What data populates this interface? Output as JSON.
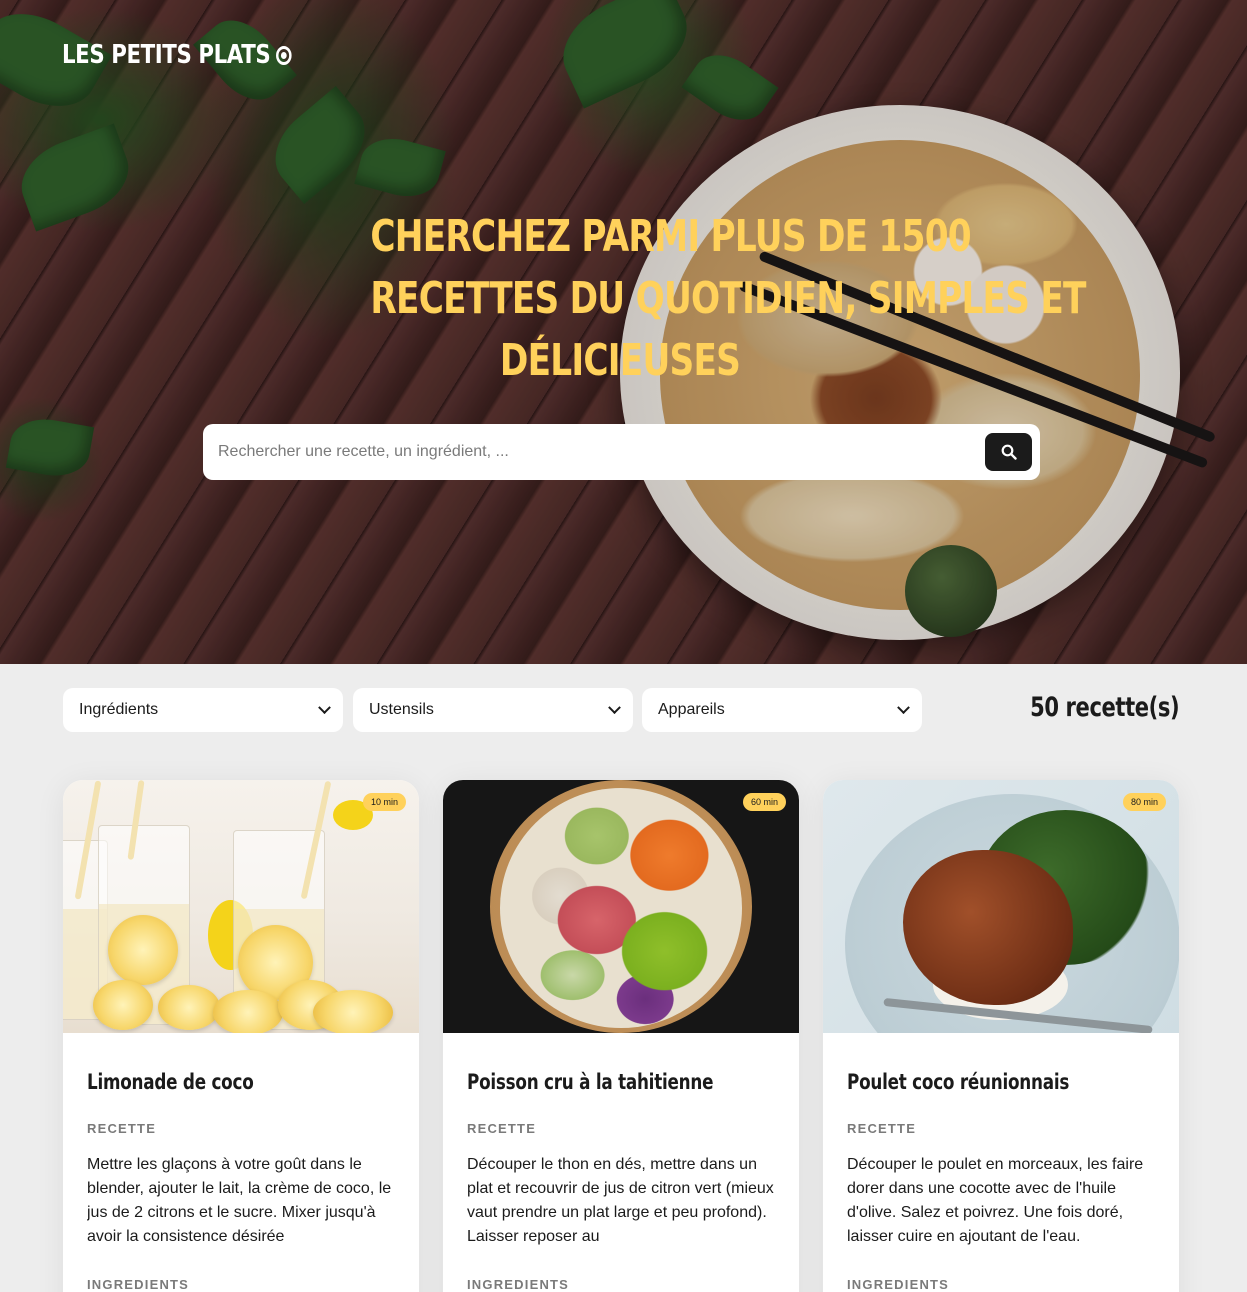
{
  "header": {
    "logo_text": "LES PETITS PLATS",
    "headline_lines": [
      "CHERCHEZ PARMI PLUS DE 1500",
      "RECETTES DU QUOTIDIEN, SIMPLES ET",
      "DÉLICIEUSES"
    ]
  },
  "search": {
    "placeholder": "Rechercher une recette, un ingrédient, ...",
    "value": "",
    "button_icon": "search-icon"
  },
  "filters": [
    {
      "label": "Ingrédients",
      "icon": "chevron-down-icon"
    },
    {
      "label": "Ustensils",
      "icon": "chevron-down-icon"
    },
    {
      "label": "Appareils",
      "icon": "chevron-down-icon"
    }
  ],
  "recipe_count": "50 recette(s)",
  "recipes": [
    {
      "time": "10 min",
      "title": "Limonade de coco",
      "recipe_heading": "RECETTE",
      "description": "Mettre les glaçons à votre goût dans le blender, ajouter le lait, la crème de coco, le jus de 2 citrons et le sucre. Mixer jusqu'à avoir la consistence désirée",
      "ingredients_heading": "INGREDIENTS"
    },
    {
      "time": "60 min",
      "title": "Poisson cru à la tahitienne",
      "recipe_heading": "RECETTE",
      "description": "Découper le thon en dés, mettre dans un plat et recouvrir de jus de citron vert (mieux vaut prendre un plat large et peu profond). Laisser reposer au",
      "ingredients_heading": "INGREDIENTS"
    },
    {
      "time": "80 min",
      "title": "Poulet coco réunionnais",
      "recipe_heading": "RECETTE",
      "description": "Découper le poulet en morceaux, les faire dorer dans une cocotte avec de l'huile d'olive. Salez et poivrez. Une fois doré, laisser cuire en ajoutant de l'eau.",
      "ingredients_heading": "INGREDIENTS"
    }
  ],
  "colors": {
    "accent_yellow": "#FFD15B",
    "dark": "#1B1B1B",
    "muted": "#7A7A7A",
    "page_bg": "#EDEDED"
  }
}
